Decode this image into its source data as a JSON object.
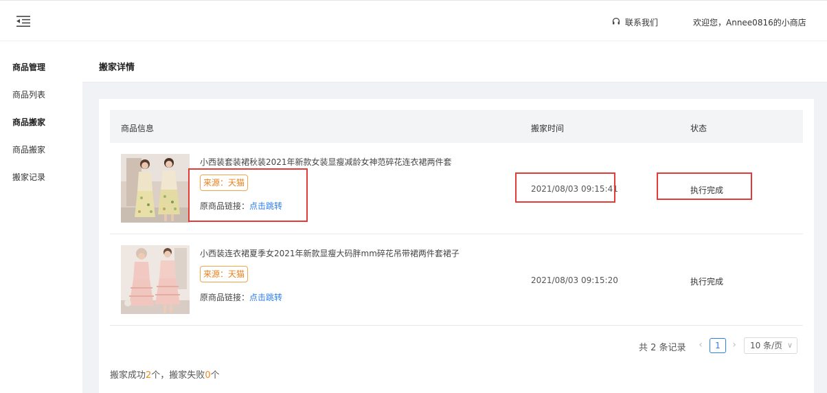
{
  "header": {
    "contact_label": "联系我们",
    "welcome_text": "欢迎您，Annee0816的小商店"
  },
  "sidebar": {
    "items": [
      {
        "label": "商品管理",
        "type": "group"
      },
      {
        "label": "商品列表",
        "type": "link"
      },
      {
        "label": "商品搬家",
        "type": "group"
      },
      {
        "label": "商品搬家",
        "type": "link"
      },
      {
        "label": "搬家记录",
        "type": "link"
      }
    ]
  },
  "page": {
    "title": "搬家详情"
  },
  "table": {
    "columns": [
      "商品信息",
      "搬家时间",
      "状态"
    ],
    "rows": [
      {
        "name": "小西装套装裙秋装2021年新款女装显瘦减龄女神范碎花连衣裙两件套",
        "source": "来源：天猫",
        "link_prefix": "原商品链接：",
        "link_text": "点击跳转",
        "time": "2021/08/03 09:15:41",
        "status": "执行完成"
      },
      {
        "name": "小西装连衣裙夏季女2021年新款显瘦大码胖mm碎花吊带裙两件套裙子",
        "source": "来源：天猫",
        "link_prefix": "原商品链接：",
        "link_text": "点击跳转",
        "time": "2021/08/03 09:15:20",
        "status": "执行完成"
      }
    ]
  },
  "pagination": {
    "total_text": "共 2 条记录",
    "current_page": "1",
    "page_size": "10 条/页"
  },
  "summary": {
    "prefix": "搬家成功",
    "success_count": "2",
    "middle": "个，搬家失败",
    "fail_count": "0",
    "suffix": "个"
  },
  "colors": {
    "accent": "#2b7de9",
    "source_tag": "#e8811b",
    "highlight_box": "#e53935",
    "count": "#f08a1d"
  }
}
